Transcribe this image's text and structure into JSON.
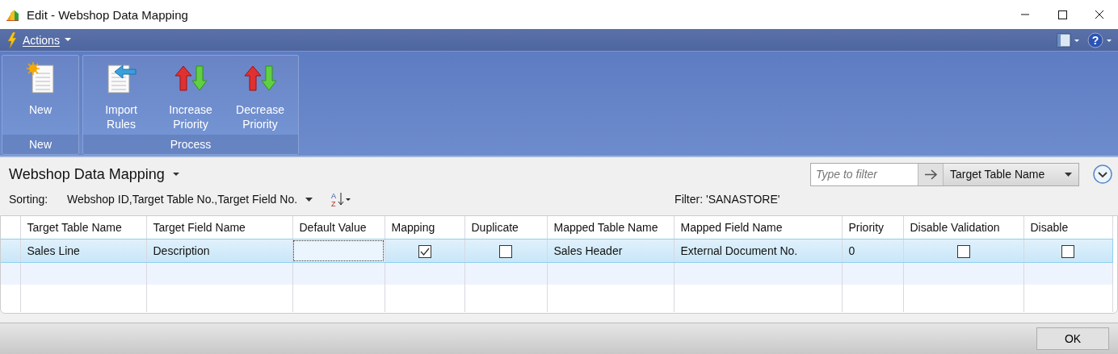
{
  "window": {
    "title": "Edit - Webshop Data Mapping"
  },
  "actions_menu": {
    "label": "Actions"
  },
  "help_menu": {
    "glyph": "?"
  },
  "sort_order": {
    "glyphs": [
      "A",
      "Z"
    ]
  },
  "ribbon": {
    "groups": [
      {
        "label": "New",
        "buttons": [
          {
            "label": "New",
            "kind": "new"
          }
        ]
      },
      {
        "label": "Process",
        "buttons": [
          {
            "label": "Import\nRules",
            "kind": "import"
          },
          {
            "label": "Increase\nPriority",
            "kind": "priority"
          },
          {
            "label": "Decrease\nPriority",
            "kind": "priority"
          }
        ]
      }
    ]
  },
  "page": {
    "title": "Webshop Data Mapping",
    "sorting_label": "Sorting:",
    "sorting": "Webshop ID,Target Table No.,Target Field No.",
    "filter": "Filter: 'SANASTORE'",
    "filter_field": {
      "placeholder": "Type to filter"
    },
    "filter_column": "Target Table Name"
  },
  "table": {
    "columns": [
      {
        "label": "Target Table Name",
        "kind": "text"
      },
      {
        "label": "Target Field Name",
        "kind": "text"
      },
      {
        "label": "Default Value",
        "kind": "field"
      },
      {
        "label": "Mapping",
        "kind": "checkbox"
      },
      {
        "label": "Duplicate",
        "kind": "checkbox"
      },
      {
        "label": "Mapped Table Name",
        "kind": "text"
      },
      {
        "label": "Mapped Field Name",
        "kind": "text"
      },
      {
        "label": "Priority",
        "kind": "text"
      },
      {
        "label": "Disable Validation",
        "kind": "checkbox"
      },
      {
        "label": "Disable",
        "kind": "checkbox"
      }
    ],
    "rows": [
      {
        "selected": true,
        "cells": [
          {
            "text": "Sales Line"
          },
          {
            "text": "Description"
          },
          {
            "focused": true
          },
          {
            "checked": true
          },
          {
            "checked": false
          },
          {
            "text": "Sales Header"
          },
          {
            "text": "External Document No."
          },
          {
            "text": "0"
          },
          {
            "checked": false
          },
          {
            "checked": false
          }
        ]
      }
    ]
  },
  "buttons": [
    {
      "label": "OK"
    }
  ]
}
